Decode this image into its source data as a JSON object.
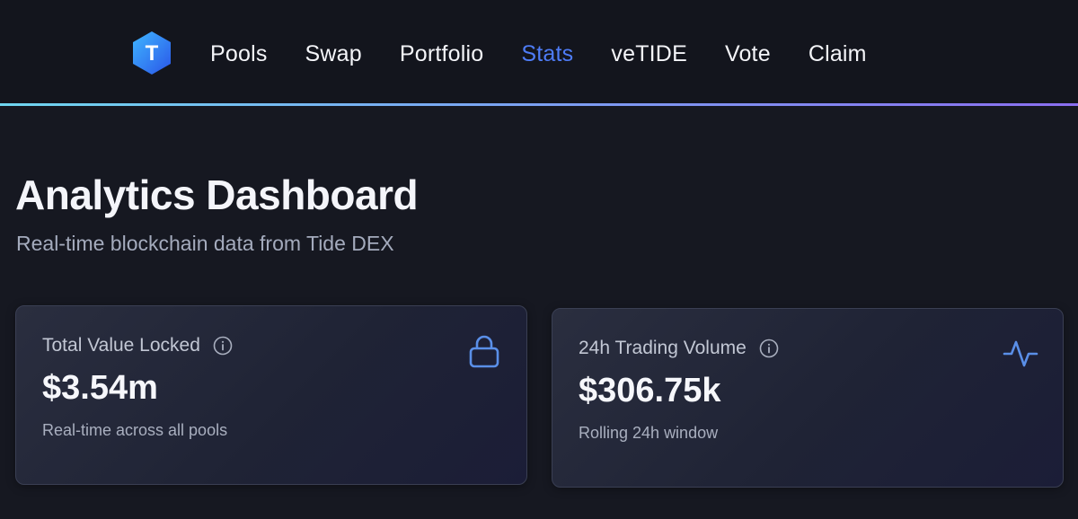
{
  "header": {
    "logo_letter": "T",
    "nav": [
      {
        "label": "Pools",
        "active": false
      },
      {
        "label": "Swap",
        "active": false
      },
      {
        "label": "Portfolio",
        "active": false
      },
      {
        "label": "Stats",
        "active": true
      },
      {
        "label": "veTIDE",
        "active": false
      },
      {
        "label": "Vote",
        "active": false
      },
      {
        "label": "Claim",
        "active": false
      }
    ]
  },
  "page": {
    "title": "Analytics Dashboard",
    "subtitle": "Real-time blockchain data from Tide DEX"
  },
  "cards": [
    {
      "label": "Total Value Locked",
      "value": "$3.54m",
      "note": "Real-time across all pools",
      "icon": "lock-icon"
    },
    {
      "label": "24h Trading Volume",
      "value": "$306.75k",
      "note": "Rolling 24h window",
      "icon": "activity-icon"
    }
  ],
  "colors": {
    "background": "#161821",
    "accent": "#4e7cf6",
    "icon_blue": "#5a8fe8"
  }
}
